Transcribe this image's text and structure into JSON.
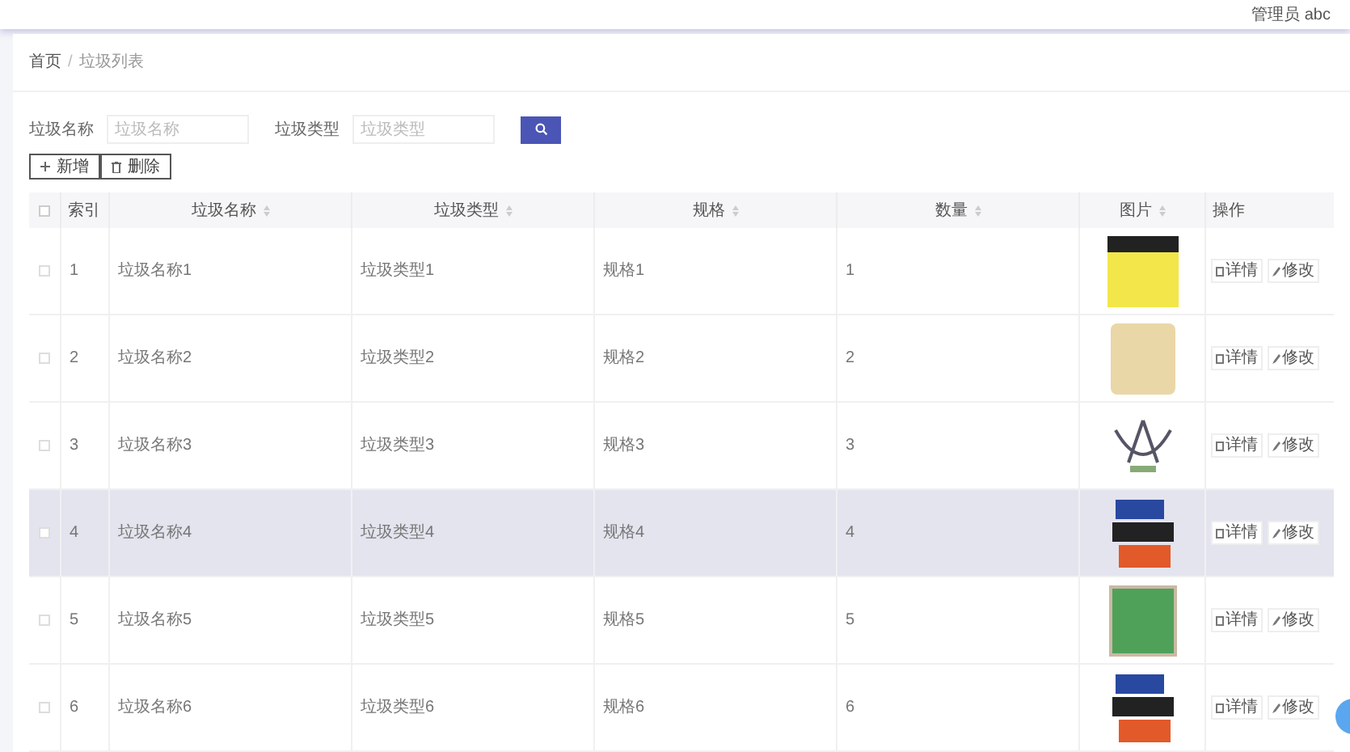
{
  "header": {
    "user": "管理员 abc"
  },
  "breadcrumb": {
    "separator": "/",
    "items": [
      "首页",
      "垃圾列表"
    ]
  },
  "search": {
    "fields": [
      {
        "label": "垃圾名称",
        "placeholder": "垃圾名称"
      },
      {
        "label": "垃圾类型",
        "placeholder": "垃圾类型"
      }
    ]
  },
  "toolbar": [
    {
      "kind": "add",
      "label": "新增"
    },
    {
      "kind": "delete",
      "label": "删除"
    }
  ],
  "table": {
    "all_checked": false,
    "columns": [
      "索引",
      "垃圾名称",
      "垃圾类型",
      "规格",
      "数量",
      "图片",
      "操作"
    ],
    "rows": [
      {
        "index": "1",
        "name": "垃圾名称1",
        "type": "垃圾类型1",
        "spec": "规格1",
        "count": "1",
        "photo": {
          "kind": "poster"
        },
        "checked": false,
        "selected": false,
        "actions": [
          "详情",
          "修改"
        ]
      },
      {
        "index": "2",
        "name": "垃圾名称2",
        "type": "垃圾类型2",
        "spec": "规格2",
        "count": "2",
        "photo": {
          "kind": "figure"
        },
        "checked": false,
        "selected": false,
        "actions": [
          "详情",
          "修改"
        ]
      },
      {
        "index": "3",
        "name": "垃圾名称3",
        "type": "垃圾类型3",
        "spec": "规格3",
        "count": "3",
        "photo": {
          "kind": "logo"
        },
        "checked": false,
        "selected": false,
        "actions": [
          "详情",
          "修改"
        ]
      },
      {
        "index": "4",
        "name": "垃圾名称4",
        "type": "垃圾类型4",
        "spec": "规格4",
        "count": "4",
        "photo": {
          "kind": "computer"
        },
        "checked": false,
        "selected": true,
        "actions": [
          "详情",
          "修改"
        ]
      },
      {
        "index": "5",
        "name": "垃圾名称5",
        "type": "垃圾类型5",
        "spec": "规格5",
        "count": "5",
        "photo": {
          "kind": "bin"
        },
        "checked": false,
        "selected": false,
        "actions": [
          "详情",
          "修改"
        ]
      },
      {
        "index": "6",
        "name": "垃圾名称6",
        "type": "垃圾类型6",
        "spec": "规格6",
        "count": "6",
        "photo": {
          "kind": "computer"
        },
        "checked": false,
        "selected": false,
        "actions": [
          "详情",
          "修改"
        ]
      }
    ]
  }
}
